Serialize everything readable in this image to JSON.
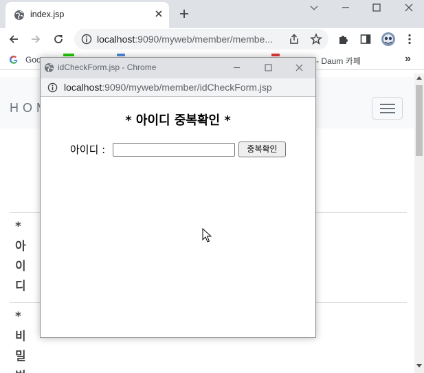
{
  "browser": {
    "tab": {
      "title": "index.jsp"
    },
    "address": {
      "host": "localhost",
      "path": ":9090/myweb/member/membe..."
    },
    "bookmarks": [
      {
        "label": "Goo"
      },
      {
        "label": "- Daum 카페"
      }
    ],
    "bookmarks_overflow": "»"
  },
  "page": {
    "brand": "HOM",
    "labels": {
      "id": [
        "*",
        "아",
        "이",
        "디"
      ],
      "password": [
        "*",
        "비",
        "밀",
        "번"
      ]
    }
  },
  "popup": {
    "title": "idCheckForm.jsp - Chrome",
    "address": {
      "host": "localhost",
      "path": ":9090/myweb/member/idCheckForm.jsp"
    },
    "heading": "* 아이디 중복확인 *",
    "id_label": "아이디 :",
    "id_value": "",
    "check_button": "중복확인"
  }
}
